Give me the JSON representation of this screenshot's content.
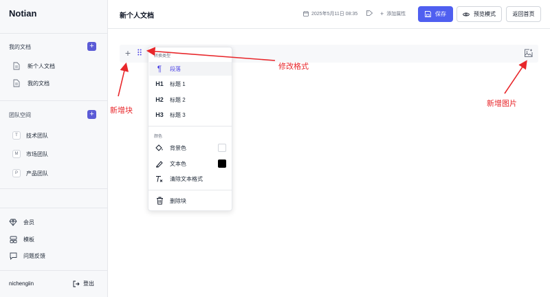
{
  "app": {
    "brand": "Notian"
  },
  "sidebar": {
    "my_docs_title": "我的文档",
    "docs": [
      {
        "label": "新个人文档",
        "icon": "document-icon"
      },
      {
        "label": "我的文档",
        "icon": "document-icon"
      }
    ],
    "team_space_title": "团队空间",
    "teams": [
      {
        "badge": "T",
        "label": "技术团队"
      },
      {
        "badge": "M",
        "label": "市场团队"
      },
      {
        "badge": "P",
        "label": "产品团队"
      }
    ],
    "footer_items": [
      {
        "label": "会员",
        "icon": "diamond-icon"
      },
      {
        "label": "模板",
        "icon": "template-icon"
      },
      {
        "label": "问题反馈",
        "icon": "chat-icon"
      }
    ],
    "username": "nichengiin",
    "logout_label": "登出"
  },
  "header": {
    "title": "新个人文档",
    "timestamp": "2025年5月11日 08:35",
    "add_property": "添加属性",
    "save_label": "保存",
    "preview_label": "预览模式",
    "home_label": "返回首页"
  },
  "block_menu": {
    "convert_title": "转换类型",
    "types": [
      {
        "icon_text": "¶",
        "label": "段落",
        "active": true
      },
      {
        "icon_text": "H1",
        "label": "标题 1"
      },
      {
        "icon_text": "H2",
        "label": "标题 2"
      },
      {
        "icon_text": "H3",
        "label": "标题 3"
      }
    ],
    "color_title": "颜色",
    "bg_color_label": "背景色",
    "text_color_label": "文本色",
    "clear_format_label": "清除文本格式",
    "delete_label": "删除块",
    "bg_swatch": "#ffffff",
    "text_swatch": "#000000"
  },
  "annotations": {
    "add_block": "新增块",
    "modify_format": "修改格式",
    "add_image": "新增图片"
  },
  "colors": {
    "accent": "#4f5ff0",
    "annotation": "#e8262a"
  }
}
